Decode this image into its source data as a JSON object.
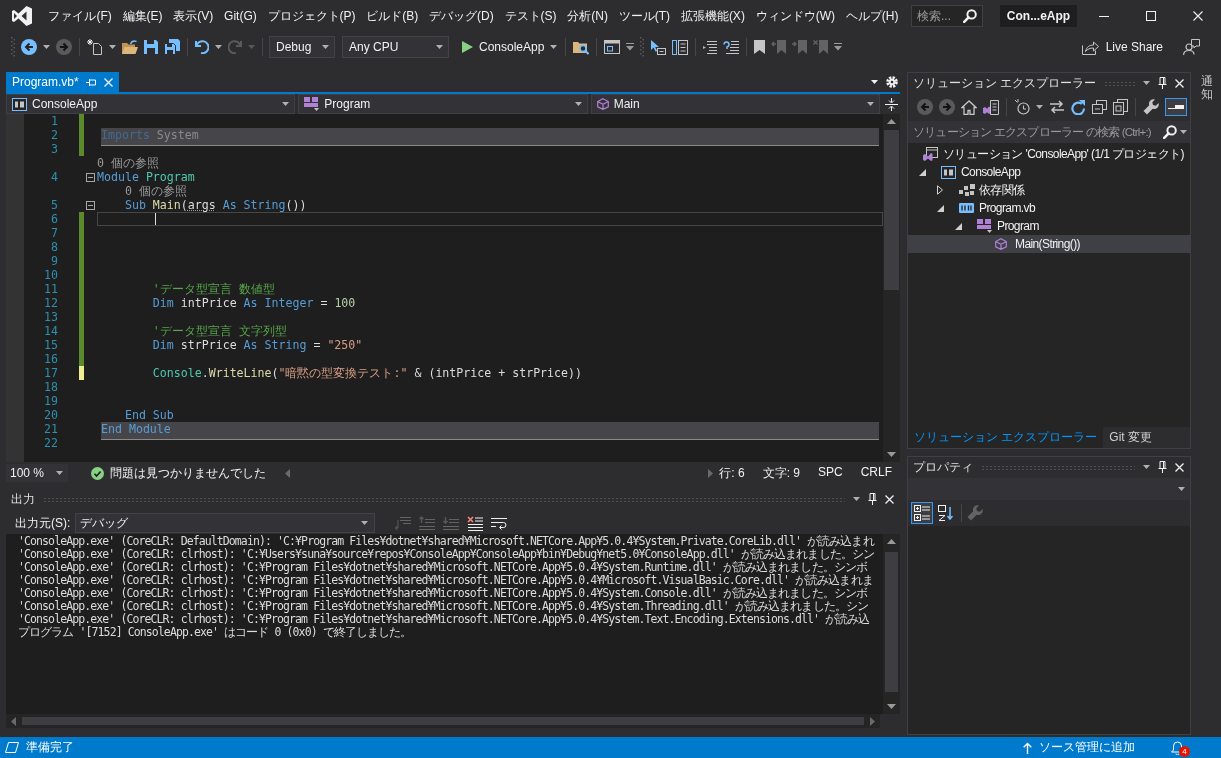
{
  "menu_bar": {
    "items": [
      "ファイル(F)",
      "編集(E)",
      "表示(V)",
      "Git(G)",
      "プロジェクト(P)",
      "ビルド(B)",
      "デバッグ(D)",
      "テスト(S)",
      "分析(N)",
      "ツール(T)",
      "拡張機能(X)",
      "ウィンドウ(W)",
      "ヘルプ(H)"
    ],
    "search": {
      "placeholder": "検索..."
    },
    "solution_name": "Con...eApp"
  },
  "toolbar": {
    "items": [
      {
        "kind": "grip"
      },
      {
        "kind": "back"
      },
      {
        "kind": "caret"
      },
      {
        "kind": "forward",
        "disabled": true
      },
      {
        "kind": "separator"
      },
      {
        "kind": "new-item"
      },
      {
        "kind": "caret"
      },
      {
        "kind": "open"
      },
      {
        "kind": "save"
      },
      {
        "kind": "save-all"
      },
      {
        "kind": "separator"
      },
      {
        "kind": "undo"
      },
      {
        "kind": "caret"
      },
      {
        "kind": "redo",
        "disabled": true
      },
      {
        "kind": "caret",
        "disabled": true
      },
      {
        "kind": "separator"
      },
      {
        "kind": "configuration",
        "text": "Debug"
      },
      {
        "kind": "platform",
        "text": "Any CPU"
      },
      {
        "kind": "start",
        "text": "ConsoleApp"
      },
      {
        "kind": "separator"
      },
      {
        "kind": "folder-search"
      },
      {
        "kind": "separator"
      },
      {
        "kind": "window"
      },
      {
        "kind": "overflow"
      },
      {
        "kind": "grip"
      },
      {
        "kind": "pointer-box"
      },
      {
        "kind": "panel-list"
      },
      {
        "kind": "separator"
      },
      {
        "kind": "indent"
      },
      {
        "kind": "outdent"
      },
      {
        "kind": "separator"
      },
      {
        "kind": "bookmark"
      },
      {
        "kind": "bookmark-previous",
        "disabled": true
      },
      {
        "kind": "bookmark-next",
        "disabled": true
      },
      {
        "kind": "bookmark-clear",
        "disabled": true
      },
      {
        "kind": "overflow"
      }
    ],
    "live_share": "Live Share"
  },
  "document_tabs": [
    {
      "title": "Program.vb*",
      "selected": true
    }
  ],
  "navigation_bar": {
    "project": "ConsoleApp",
    "type": "Program",
    "member": "Main"
  },
  "code_lines": [
    {
      "kind": "code",
      "number": "1",
      "color": "#5b8a2d"
    },
    {
      "kind": "code",
      "number": "2",
      "color": "#5b8a2d",
      "separator": true,
      "tokens": [
        {
          "kind": "dim-keyword",
          "text": "Imports"
        },
        {
          "kind": "dim-plain",
          "text": " System"
        }
      ]
    },
    {
      "kind": "code",
      "number": "3",
      "color": "#5b8a2d"
    },
    {
      "kind": "codelens",
      "text": "0 個の参照"
    },
    {
      "kind": "code",
      "number": "4",
      "fold": {
        "expanded": true
      },
      "tokens": [
        {
          "kind": "keyword",
          "text": "Module "
        },
        {
          "kind": "type",
          "text": "Program"
        }
      ]
    },
    {
      "kind": "codelens",
      "text": "    0 個の参照"
    },
    {
      "kind": "code",
      "number": "5",
      "fold": {
        "expanded": true
      },
      "tokens": [
        {
          "kind": "keyword",
          "text": "    Sub "
        },
        {
          "kind": "method",
          "text": "Main"
        },
        {
          "kind": "plain",
          "text": "("
        },
        {
          "kind": "hinted",
          "text": "args"
        },
        {
          "kind": "keyword",
          "text": " As String"
        },
        {
          "kind": "plain",
          "text": "())"
        }
      ]
    },
    {
      "kind": "code",
      "number": "6",
      "color": "#5b8a2d",
      "current": true
    },
    {
      "kind": "code",
      "number": "7",
      "color": "#5b8a2d"
    },
    {
      "kind": "code",
      "number": "8",
      "color": "#5b8a2d"
    },
    {
      "kind": "code",
      "number": "9",
      "color": "#5b8a2d"
    },
    {
      "kind": "code",
      "number": "10",
      "color": "#5b8a2d"
    },
    {
      "kind": "code",
      "number": "11",
      "color": "#5b8a2d",
      "tokens": [
        {
          "kind": "comment",
          "text": "        'データ型宣言 数値型"
        }
      ]
    },
    {
      "kind": "code",
      "number": "12",
      "color": "#5b8a2d",
      "tokens": [
        {
          "kind": "keyword",
          "text": "        Dim"
        },
        {
          "kind": "variable",
          "text": " intPrice "
        },
        {
          "kind": "keyword",
          "text": "As Integer"
        },
        {
          "kind": "plain",
          "text": " = "
        },
        {
          "kind": "number",
          "text": "100"
        }
      ]
    },
    {
      "kind": "code",
      "number": "13",
      "color": "#5b8a2d"
    },
    {
      "kind": "code",
      "number": "14",
      "color": "#5b8a2d",
      "tokens": [
        {
          "kind": "comment",
          "text": "        'データ型宣言 文字列型"
        }
      ]
    },
    {
      "kind": "code",
      "number": "15",
      "color": "#5b8a2d",
      "tokens": [
        {
          "kind": "keyword",
          "text": "        Dim"
        },
        {
          "kind": "variable",
          "text": " strPrice "
        },
        {
          "kind": "keyword",
          "text": "As String"
        },
        {
          "kind": "plain",
          "text": " = "
        },
        {
          "kind": "string",
          "text": "\"250\""
        }
      ]
    },
    {
      "kind": "code",
      "number": "16",
      "color": "#5b8a2d"
    },
    {
      "kind": "code",
      "number": "17",
      "color": "#efef91",
      "tokens": [
        {
          "kind": "type",
          "text": "        Console"
        },
        {
          "kind": "plain",
          "text": "."
        },
        {
          "kind": "method",
          "text": "WriteLine"
        },
        {
          "kind": "plain",
          "text": "("
        },
        {
          "kind": "string",
          "text": "\"暗黙の型変換テスト:\""
        },
        {
          "kind": "plain",
          "text": " & ("
        },
        {
          "kind": "variable",
          "text": "intPrice"
        },
        {
          "kind": "plain",
          "text": " + "
        },
        {
          "kind": "variable",
          "text": "strPrice"
        },
        {
          "kind": "plain",
          "text": "))"
        }
      ]
    },
    {
      "kind": "code",
      "number": "18"
    },
    {
      "kind": "code",
      "number": "19"
    },
    {
      "kind": "code",
      "number": "20",
      "tokens": [
        {
          "kind": "keyword",
          "text": "    End Sub"
        }
      ]
    },
    {
      "kind": "code",
      "number": "21",
      "separator": true,
      "tokens": [
        {
          "kind": "keyword",
          "text": "End Module"
        }
      ]
    },
    {
      "kind": "code",
      "number": "22"
    }
  ],
  "editor_status": {
    "zoom": "100 %",
    "issues": "問題は見つかりませんでした",
    "line": "行: 6",
    "column": "文字: 9",
    "whitespace": "SPC",
    "line_ending": "CRLF"
  },
  "output_panel": {
    "title": "出力",
    "source_label": "出力元(S):",
    "source": "デバッグ",
    "tools": [
      {
        "kind": "goto",
        "disabled": true
      },
      {
        "kind": "previous",
        "disabled": true
      },
      {
        "kind": "next",
        "disabled": true
      },
      {
        "kind": "clear"
      },
      {
        "kind": "word-wrap"
      }
    ],
    "lines": [
      "'ConsoleApp.exe' (CoreCLR: DefaultDomain): 'C:¥Program Files¥dotnet¥shared¥Microsoft.NETCore.App¥5.0.4¥System.Private.CoreLib.dll' が読み込まれ",
      "'ConsoleApp.exe' (CoreCLR: clrhost): 'C:¥Users¥suna¥source¥repos¥ConsoleApp¥ConsoleApp¥bin¥Debug¥net5.0¥ConsoleApp.dll' が読み込まれました。シン",
      "'ConsoleApp.exe' (CoreCLR: clrhost): 'C:¥Program Files¥dotnet¥shared¥Microsoft.NETCore.App¥5.0.4¥System.Runtime.dll' が読み込まれました。シンボ",
      "'ConsoleApp.exe' (CoreCLR: clrhost): 'C:¥Program Files¥dotnet¥shared¥Microsoft.NETCore.App¥5.0.4¥Microsoft.VisualBasic.Core.dll' が読み込まれま",
      "'ConsoleApp.exe' (CoreCLR: clrhost): 'C:¥Program Files¥dotnet¥shared¥Microsoft.NETCore.App¥5.0.4¥System.Console.dll' が読み込まれました。シンボ",
      "'ConsoleApp.exe' (CoreCLR: clrhost): 'C:¥Program Files¥dotnet¥shared¥Microsoft.NETCore.App¥5.0.4¥System.Threading.dll' が読み込まれました。シン",
      "'ConsoleApp.exe' (CoreCLR: clrhost): 'C:¥Program Files¥dotnet¥shared¥Microsoft.NETCore.App¥5.0.4¥System.Text.Encoding.Extensions.dll' が読み込",
      "プログラム '[7152] ConsoleApp.exe' はコード 0 (0x0) で終了しました。"
    ]
  },
  "solution_explorer": {
    "title": "ソリューション エクスプローラー",
    "tools": [
      {
        "kind": "back",
        "disabled": true
      },
      {
        "kind": "forward",
        "disabled": true
      },
      {
        "kind": "home"
      },
      {
        "kind": "switch-views"
      },
      {
        "kind": "separator"
      },
      {
        "kind": "pending"
      },
      {
        "kind": "caret"
      },
      {
        "kind": "sync"
      },
      {
        "kind": "refresh"
      },
      {
        "kind": "collapse-all"
      },
      {
        "kind": "show-all-files"
      },
      {
        "kind": "separator"
      },
      {
        "kind": "properties"
      },
      {
        "kind": "preview",
        "on": true
      }
    ],
    "search": {
      "placeholder": "ソリューション エクスプローラー の検索 (Ctrl+:)"
    },
    "tree": [
      {
        "label": "ソリューション 'ConsoleApp' (1/1 プロジェクト)",
        "kind": "solution",
        "selected": false,
        "children": [
          {
            "label": "ConsoleApp",
            "kind": "vb-project",
            "expanded": true,
            "selected": false,
            "children": [
              {
                "label": "依存関係",
                "kind": "dependencies",
                "expanded": false,
                "selected": false
              },
              {
                "label": "Program.vb",
                "kind": "vb-file",
                "expanded": true,
                "selected": false,
                "children": [
                  {
                    "label": "Program",
                    "kind": "class",
                    "expanded": true,
                    "selected": false,
                    "children": [
                      {
                        "label": "Main(String())",
                        "kind": "method",
                        "selected": true
                      }
                    ]
                  }
                ]
              }
            ]
          }
        ]
      }
    ],
    "tabs": [
      {
        "label": "ソリューション エクスプローラー",
        "selected": true
      },
      {
        "label": "Git 変更",
        "selected": false
      }
    ]
  },
  "properties_panel": {
    "title": "プロパティ",
    "tools": [
      {
        "kind": "categorized",
        "on": true
      },
      {
        "kind": "alphabetical",
        "on": false
      },
      {
        "kind": "separator"
      },
      {
        "kind": "property-pages",
        "disabled": true
      }
    ]
  },
  "side_tabs": [
    {
      "label": "通知"
    }
  ],
  "status_bar": {
    "message": "準備完了",
    "source_control": "ソース管理に追加",
    "notification_count": "4"
  }
}
